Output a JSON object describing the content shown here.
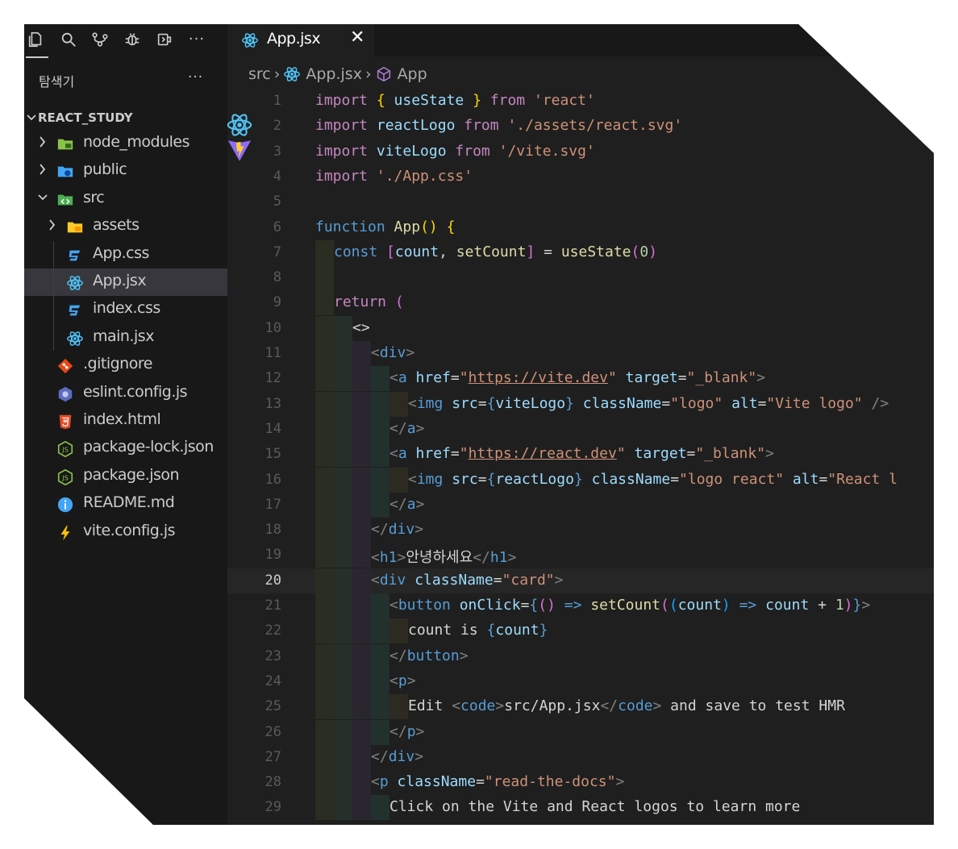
{
  "sidebar": {
    "explorer_title": "탐색기",
    "more": "···",
    "project": "REACT_STUDY",
    "items": [
      {
        "label": "node_modules",
        "icon": "folder-node-icon",
        "type": "folder",
        "depth": 0,
        "expanded": false
      },
      {
        "label": "public",
        "icon": "folder-public-icon",
        "type": "folder",
        "depth": 0,
        "expanded": false
      },
      {
        "label": "src",
        "icon": "folder-src-icon",
        "type": "folder",
        "depth": 0,
        "expanded": true
      },
      {
        "label": "assets",
        "icon": "folder-assets-icon",
        "type": "folder",
        "depth": 1,
        "expanded": false
      },
      {
        "label": "App.css",
        "icon": "css-icon",
        "type": "file",
        "depth": 1
      },
      {
        "label": "App.jsx",
        "icon": "react-icon",
        "type": "file",
        "depth": 1,
        "selected": true
      },
      {
        "label": "index.css",
        "icon": "css-icon",
        "type": "file",
        "depth": 1
      },
      {
        "label": "main.jsx",
        "icon": "react-icon",
        "type": "file",
        "depth": 1
      },
      {
        "label": ".gitignore",
        "icon": "git-icon",
        "type": "file",
        "depth": 0
      },
      {
        "label": "eslint.config.js",
        "icon": "eslint-icon",
        "type": "file",
        "depth": 0
      },
      {
        "label": "index.html",
        "icon": "html-icon",
        "type": "file",
        "depth": 0
      },
      {
        "label": "package-lock.json",
        "icon": "nodejs-icon",
        "type": "file",
        "depth": 0
      },
      {
        "label": "package.json",
        "icon": "nodejs-icon",
        "type": "file",
        "depth": 0
      },
      {
        "label": "README.md",
        "icon": "info-icon",
        "type": "file",
        "depth": 0
      },
      {
        "label": "vite.config.js",
        "icon": "vite-icon",
        "type": "file",
        "depth": 0
      }
    ]
  },
  "tab": {
    "label": "App.jsx",
    "close": "✕"
  },
  "breadcrumb": {
    "folder": "src",
    "file": "App.jsx",
    "symbol": "App"
  },
  "editor": {
    "current_line": 20,
    "lines": [
      {
        "n": "1"
      },
      {
        "n": "2"
      },
      {
        "n": "3"
      },
      {
        "n": "4"
      },
      {
        "n": "5"
      },
      {
        "n": "6"
      },
      {
        "n": "7"
      },
      {
        "n": "8"
      },
      {
        "n": "9"
      },
      {
        "n": "10"
      },
      {
        "n": "11"
      },
      {
        "n": "12"
      },
      {
        "n": "13"
      },
      {
        "n": "14"
      },
      {
        "n": "15"
      },
      {
        "n": "16"
      },
      {
        "n": "17"
      },
      {
        "n": "18"
      },
      {
        "n": "19"
      },
      {
        "n": "20"
      },
      {
        "n": "21"
      },
      {
        "n": "22"
      },
      {
        "n": "23"
      },
      {
        "n": "24"
      },
      {
        "n": "25"
      },
      {
        "n": "26"
      },
      {
        "n": "27"
      },
      {
        "n": "28"
      },
      {
        "n": "29"
      }
    ],
    "code": {
      "l1": [
        "import",
        " ",
        "{",
        " useState ",
        "}",
        " ",
        "from",
        " ",
        "'react'"
      ],
      "l2": [
        "import",
        " reactLogo ",
        "from",
        " ",
        "'./assets/react.svg'"
      ],
      "l3": [
        "import",
        " viteLogo ",
        "from",
        " ",
        "'/vite.svg'"
      ],
      "l4": [
        "import",
        " ",
        "'./App.css'"
      ],
      "l6": [
        "function",
        " ",
        "App",
        "()",
        " ",
        "{"
      ],
      "l7": [
        "const",
        " ",
        "[",
        "count",
        ",",
        " ",
        "setCount",
        "]",
        " = ",
        "useState",
        "(",
        "0",
        ")"
      ],
      "l9": [
        "return",
        " ",
        "("
      ],
      "l10": [
        "<>"
      ],
      "l11": [
        "<",
        "div",
        ">"
      ],
      "l12": [
        "<",
        "a",
        " ",
        "href",
        "=",
        "\"",
        "https://vite.dev",
        "\"",
        " ",
        "target",
        "=",
        "\"_blank\"",
        ">"
      ],
      "l13": [
        "<",
        "img",
        " ",
        "src",
        "=",
        "{",
        "viteLogo",
        "}",
        " ",
        "className",
        "=",
        "\"logo\"",
        " ",
        "alt",
        "=",
        "\"Vite logo\"",
        " />"
      ],
      "l14": [
        "</",
        "a",
        ">"
      ],
      "l15": [
        "<",
        "a",
        " ",
        "href",
        "=",
        "\"",
        "https://react.dev",
        "\"",
        " ",
        "target",
        "=",
        "\"_blank\"",
        ">"
      ],
      "l16": [
        "<",
        "img",
        " ",
        "src",
        "=",
        "{",
        "reactLogo",
        "}",
        " ",
        "className",
        "=",
        "\"logo react\"",
        " ",
        "alt",
        "=",
        "\"React l"
      ],
      "l17": [
        "</",
        "a",
        ">"
      ],
      "l18": [
        "</",
        "div",
        ">"
      ],
      "l19": [
        "<",
        "h1",
        ">",
        "안녕하세요",
        "</",
        "h1",
        ">"
      ],
      "l20": [
        "<",
        "div",
        " ",
        "className",
        "=",
        "\"card\"",
        ">"
      ],
      "l21": [
        "<",
        "button",
        " ",
        "onClick",
        "=",
        "{",
        "(",
        ")",
        " ",
        "=>",
        " ",
        "setCount",
        "(",
        "(",
        "count",
        ")",
        " ",
        "=>",
        " ",
        "count",
        " + ",
        "1",
        ")",
        "}",
        ">"
      ],
      "l22": [
        "count is ",
        "{",
        "count",
        "}"
      ],
      "l23": [
        "</",
        "button",
        ">"
      ],
      "l24": [
        "<",
        "p",
        ">"
      ],
      "l25": [
        "Edit ",
        "<",
        "code",
        ">",
        "src/App.jsx",
        "</",
        "code",
        ">",
        " and save to test HMR"
      ],
      "l26": [
        "</",
        "p",
        ">"
      ],
      "l27": [
        "</",
        "div",
        ">"
      ],
      "l28": [
        "<",
        "p",
        " ",
        "className",
        "=",
        "\"read-the-docs\"",
        ">"
      ],
      "l29": [
        "Click on the Vite and React logos to learn more"
      ]
    }
  },
  "colors": {
    "background": "#1f1f1f",
    "sidebar": "#181818",
    "selected": "#37373d",
    "keyword": "#c586c0",
    "string": "#ce9178",
    "tag": "#569cd6",
    "attr": "#9cdcfe",
    "func": "#dcdcaa"
  }
}
